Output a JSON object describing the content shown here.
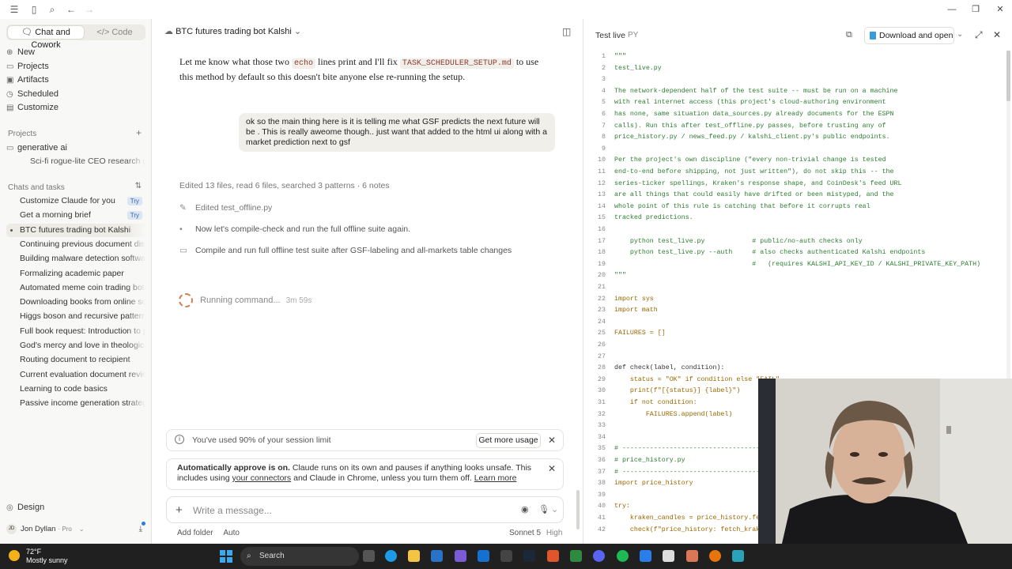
{
  "sidebar": {
    "mode_chat": "Chat and Cowork",
    "mode_code": "Code",
    "nav": [
      "New",
      "Projects",
      "Artifacts",
      "Scheduled",
      "Customize"
    ],
    "projects_header": "Projects",
    "projects": [
      "generative ai",
      "Sci-fi rogue-lite CEO research gam"
    ],
    "chats_header": "Chats and tasks",
    "chats": [
      {
        "label": "Customize Claude for you",
        "badge": "Try"
      },
      {
        "label": "Get a morning brief",
        "badge": "Try"
      },
      {
        "label": "BTC futures trading bot Kalshi",
        "badge": ""
      },
      {
        "label": "Continuing previous document discu",
        "badge": ""
      },
      {
        "label": "Building malware detection software",
        "badge": ""
      },
      {
        "label": "Formalizing academic paper",
        "badge": ""
      },
      {
        "label": "Automated meme coin trading bot",
        "badge": ""
      },
      {
        "label": "Downloading books from online sourc",
        "badge": ""
      },
      {
        "label": "Higgs boson and recursive patterns",
        "badge": ""
      },
      {
        "label": "Full book request: Introduction to pul",
        "badge": ""
      },
      {
        "label": "God's mercy and love in theological ev",
        "badge": ""
      },
      {
        "label": "Routing document to recipient",
        "badge": ""
      },
      {
        "label": "Current evaluation document review",
        "badge": ""
      },
      {
        "label": "Learning to code basics",
        "badge": ""
      },
      {
        "label": "Passive income generation strategies",
        "badge": ""
      }
    ],
    "design": "Design",
    "user_name": "Jon Dyllan",
    "user_plan": "Pro",
    "user_initials": "JD"
  },
  "main": {
    "title": "BTC futures trading bot Kalshi",
    "assistant_msg_a": "Let me know what those two",
    "assistant_code_a": "echo",
    "assistant_msg_b": "lines print and I'll fix",
    "assistant_code_b": "TASK_SCHEDULER_SETUP.md",
    "assistant_msg_c": "to use this method by default so this doesn't bite anyone else re-running the setup.",
    "user_msg": "ok so the main thing here is it is telling me what GSF predicts the next future will be . This is really aweome though.. just want that added to the html ui along with a market prediction next to gsf",
    "summary": "Edited 13 files, read 6 files, searched 3 patterns · 6 notes",
    "steps": [
      "Edited test_offline.py",
      "Now let's compile-check and run the full offline suite again.",
      "Compile and run full offline test suite after GSF-labeling and all-markets table changes"
    ],
    "running": "Running command...",
    "running_time": "3m 59s",
    "limit_text": "You've used 90% of your session limit",
    "limit_button": "Get more usage",
    "approve_bold": "Automatically approve is on.",
    "approve_a": "Claude runs on its own and pauses if anything looks unsafe. This includes using",
    "approve_link1": "your connectors",
    "approve_b": "and Claude in Chrome, unless you turn them off.",
    "approve_link2": "Learn more",
    "composer_placeholder": "Write a message...",
    "add_folder": "Add folder",
    "auto": "Auto",
    "model": "Sonnet 5",
    "effort": "High"
  },
  "panel": {
    "file_name": "Test live",
    "file_ext": "PY",
    "download_button": "Download and open",
    "lines": [
      {
        "n": 1,
        "t": "\"\"\"",
        "c": "s"
      },
      {
        "n": 2,
        "t": "test_live.py",
        "c": "s"
      },
      {
        "n": 3,
        "t": "",
        "c": "s"
      },
      {
        "n": 4,
        "t": "The network-dependent half of the test suite -- must be run on a machine",
        "c": "s"
      },
      {
        "n": 5,
        "t": "with real internet access (this project's cloud-authoring environment",
        "c": "s"
      },
      {
        "n": 6,
        "t": "has none, same situation data_sources.py already documents for the ESPN",
        "c": "s"
      },
      {
        "n": 7,
        "t": "calls). Run this after test_offline.py passes, before trusting any of",
        "c": "s"
      },
      {
        "n": 8,
        "t": "price_history.py / news_feed.py / kalshi_client.py's public endpoints.",
        "c": "s"
      },
      {
        "n": 9,
        "t": "",
        "c": "s"
      },
      {
        "n": 10,
        "t": "Per the project's own discipline (\"every non-trivial change is tested",
        "c": "s"
      },
      {
        "n": 11,
        "t": "end-to-end before shipping, not just written\"), do not skip this -- the",
        "c": "s"
      },
      {
        "n": 12,
        "t": "series-ticker spellings, Kraken's response shape, and CoinDesk's feed URL",
        "c": "s"
      },
      {
        "n": 13,
        "t": "are all things that could easily have drifted or been mistyped, and the",
        "c": "s"
      },
      {
        "n": 14,
        "t": "whole point of this rule is catching that before it corrupts real",
        "c": "s"
      },
      {
        "n": 15,
        "t": "tracked predictions.",
        "c": "s"
      },
      {
        "n": 16,
        "t": "",
        "c": "s"
      },
      {
        "n": 17,
        "t": "    python test_live.py            # public/no-auth checks only",
        "c": "s"
      },
      {
        "n": 18,
        "t": "    python test_live.py --auth     # also checks authenticated Kalshi endpoints",
        "c": "s"
      },
      {
        "n": 19,
        "t": "                                   #   (requires KALSHI_API_KEY_ID / KALSHI_PRIVATE_KEY_PATH)",
        "c": "s"
      },
      {
        "n": 20,
        "t": "\"\"\"",
        "c": "s"
      },
      {
        "n": 21,
        "t": "",
        "c": "d"
      },
      {
        "n": 22,
        "t": "import sys",
        "c": "k"
      },
      {
        "n": 23,
        "t": "import math",
        "c": "k"
      },
      {
        "n": 24,
        "t": "",
        "c": "d"
      },
      {
        "n": 25,
        "t": "FAILURES = []",
        "c": "k"
      },
      {
        "n": 26,
        "t": "",
        "c": "d"
      },
      {
        "n": 27,
        "t": "",
        "c": "d"
      },
      {
        "n": 28,
        "t": "def check(label, condition):",
        "c": "d"
      },
      {
        "n": 29,
        "t": "    status = \"OK\" if condition else \"FAIL\"",
        "c": "k"
      },
      {
        "n": 30,
        "t": "    print(f\"[{status}] {label}\")",
        "c": "k"
      },
      {
        "n": 31,
        "t": "    if not condition:",
        "c": "k"
      },
      {
        "n": 32,
        "t": "        FAILURES.append(label)",
        "c": "k"
      },
      {
        "n": 33,
        "t": "",
        "c": "d"
      },
      {
        "n": 34,
        "t": "",
        "c": "d"
      },
      {
        "n": 35,
        "t": "# ----------------------------------------",
        "c": "s"
      },
      {
        "n": 36,
        "t": "# price_history.py",
        "c": "s"
      },
      {
        "n": 37,
        "t": "# ----------------------------------------",
        "c": "s"
      },
      {
        "n": 38,
        "t": "import price_history",
        "c": "k"
      },
      {
        "n": 39,
        "t": "",
        "c": "d"
      },
      {
        "n": 40,
        "t": "try:",
        "c": "k"
      },
      {
        "n": 41,
        "t": "    kraken_candles = price_history.fet",
        "c": "k"
      },
      {
        "n": 42,
        "t": "    check(f\"price_history: fetch_krake",
        "c": "k"
      }
    ]
  },
  "taskbar": {
    "temp": "72°F",
    "weather": "Mostly sunny",
    "search_placeholder": "Search"
  },
  "colors": {
    "accent": "#d08050",
    "string": "#2e7d32",
    "keyword": "#9a6700",
    "taskbar": "#202020"
  }
}
